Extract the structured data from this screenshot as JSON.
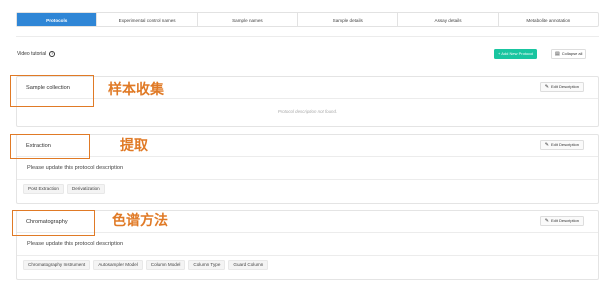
{
  "tabs": [
    {
      "label": "Protocols",
      "active": true
    },
    {
      "label": "Experimental control names",
      "active": false
    },
    {
      "label": "Sample names",
      "active": false
    },
    {
      "label": "Sample details",
      "active": false
    },
    {
      "label": "Assay details",
      "active": false
    },
    {
      "label": "Metabolite annotation",
      "active": false
    }
  ],
  "toolbar": {
    "video_tutorial": "Video tutorial",
    "help_glyph": "?",
    "add_button": "+ Add New Protocol",
    "collapse_button": "Collapse all",
    "collapse_glyph": "▤"
  },
  "edit_label": "Edit Description",
  "pencil_glyph": "✎",
  "protocols": [
    {
      "title": "Sample collection",
      "annotation": "样本收集",
      "empty_text": "Protocol description not found."
    },
    {
      "title": "Extraction",
      "annotation": "提取",
      "description": "Please update this protocol description",
      "chips": [
        "Post Extraction",
        "Derivatization"
      ]
    },
    {
      "title": "Chromatography",
      "annotation": "色谱方法",
      "description": "Please update this protocol description",
      "chips": [
        "Chromatography Instrument",
        "Autosampler Model",
        "Column Model",
        "Column Type",
        "Guard Column"
      ]
    }
  ],
  "colors": {
    "tab_active": "#2f86d6",
    "add_button": "#19c5a0",
    "annotation": "#e07a26"
  }
}
